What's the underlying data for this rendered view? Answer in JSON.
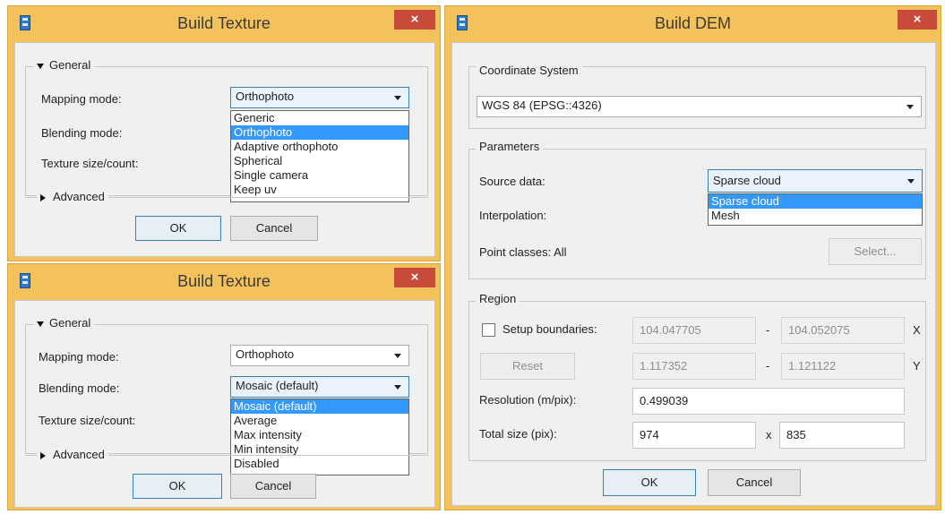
{
  "build_texture_1": {
    "title": "Build Texture",
    "close": "×",
    "group_general": "General",
    "mapping_label": "Mapping mode:",
    "mapping_value": "Orthophoto",
    "blending_label": "Blending mode:",
    "texture_label": "Texture size/count:",
    "mapping_options": [
      "Generic",
      "Orthophoto",
      "Adaptive orthophoto",
      "Spherical",
      "Single camera",
      "Keep uv"
    ],
    "advanced_label": "Advanced",
    "ok": "OK",
    "cancel": "Cancel"
  },
  "build_texture_2": {
    "title": "Build Texture",
    "close": "×",
    "group_general": "General",
    "mapping_label": "Mapping mode:",
    "mapping_value": "Orthophoto",
    "blending_label": "Blending mode:",
    "blending_value": "Mosaic (default)",
    "texture_label": "Texture size/count:",
    "blending_options": [
      "Mosaic (default)",
      "Average",
      "Max intensity",
      "Min intensity",
      "Disabled"
    ],
    "advanced_label": "Advanced",
    "ok": "OK",
    "cancel": "Cancel"
  },
  "build_dem": {
    "title": "Build DEM",
    "close": "×",
    "coord_group": "Coordinate System",
    "coord_value": "WGS 84 (EPSG::4326)",
    "params_group": "Parameters",
    "source_label": "Source data:",
    "source_value": "Sparse cloud",
    "source_options": [
      "Sparse cloud",
      "Mesh"
    ],
    "interp_label": "Interpolation:",
    "point_classes_label": "Point classes: All",
    "select_btn": "Select...",
    "region_group": "Region",
    "setup_label": "Setup boundaries:",
    "x_min": "104.047705",
    "x_max": "104.052075",
    "y_min": "1.117352",
    "y_max": "1.121122",
    "dash": "-",
    "x_axis": "X",
    "y_axis": "Y",
    "reset_btn": "Reset",
    "resolution_label": "Resolution (m/pix):",
    "resolution_value": "0.499039",
    "total_label": "Total size (pix):",
    "total_w": "974",
    "times": "x",
    "total_h": "835",
    "ok": "OK",
    "cancel": "Cancel"
  }
}
